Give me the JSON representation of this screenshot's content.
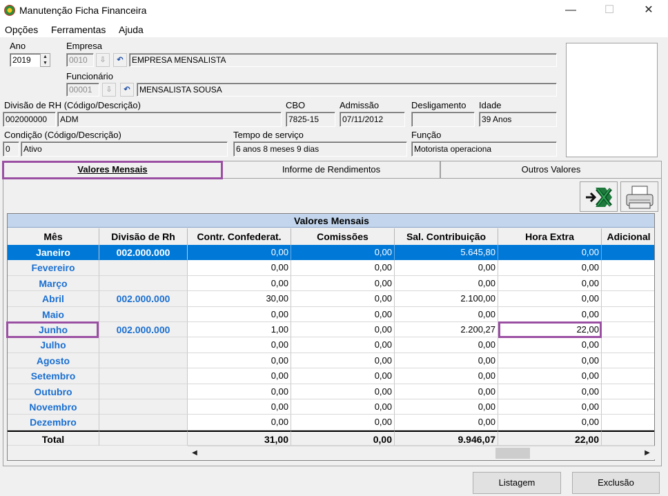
{
  "window": {
    "title": "Manutenção Ficha Financeira",
    "minimize": "—",
    "maximize": "☐",
    "close": "✕"
  },
  "menu": [
    "Opções",
    "Ferramentas",
    "Ajuda"
  ],
  "header": {
    "ano_label": "Ano",
    "ano_value": "2019",
    "empresa_label": "Empresa",
    "empresa_code": "0010",
    "empresa_name": "EMPRESA MENSALISTA",
    "funcionario_label": "Funcionário",
    "funcionario_code": "00001",
    "funcionario_name": "MENSALISTA SOUSA",
    "divisao_label": "Divisão de RH (Código/Descrição)",
    "divisao_code": "002000000",
    "divisao_desc": "ADM",
    "cbo_label": "CBO",
    "cbo_value": "7825-15",
    "admissao_label": "Admissão",
    "admissao_value": "07/11/2012",
    "desligamento_label": "Desligamento",
    "desligamento_value": "",
    "idade_label": "Idade",
    "idade_value": "39 Anos",
    "condicao_label": "Condição (Código/Descrição)",
    "condicao_code": "0",
    "condicao_desc": "Ativo",
    "tempo_label": "Tempo de serviço",
    "tempo_value": "6 anos 8 meses 9 dias",
    "funcao_label": "Função",
    "funcao_value": "Motorista operaciona"
  },
  "tabs": [
    "Valores Mensais",
    "Informe de Rendimentos",
    "Outros Valores"
  ],
  "toolbar": {
    "excel_icon": "excel-export-icon",
    "print_icon": "printer-icon"
  },
  "grid": {
    "caption": "Valores Mensais",
    "columns": [
      "Mês",
      "Divisão de Rh",
      "Contr. Confederat.",
      "Comissões",
      "Sal. Contribuição",
      "Hora Extra",
      "Adicional"
    ],
    "rows": [
      {
        "mes": "Janeiro",
        "divisao": "002.000.000",
        "contr": "0,00",
        "comissoes": "0,00",
        "sal": "5.645,80",
        "hora_extra": "0,00",
        "selected": true
      },
      {
        "mes": "Fevereiro",
        "divisao": "",
        "contr": "0,00",
        "comissoes": "0,00",
        "sal": "0,00",
        "hora_extra": "0,00"
      },
      {
        "mes": "Março",
        "divisao": "",
        "contr": "0,00",
        "comissoes": "0,00",
        "sal": "0,00",
        "hora_extra": "0,00"
      },
      {
        "mes": "Abril",
        "divisao": "002.000.000",
        "contr": "30,00",
        "comissoes": "0,00",
        "sal": "2.100,00",
        "hora_extra": "0,00"
      },
      {
        "mes": "Maio",
        "divisao": "",
        "contr": "0,00",
        "comissoes": "0,00",
        "sal": "0,00",
        "hora_extra": "0,00"
      },
      {
        "mes": "Junho",
        "divisao": "002.000.000",
        "contr": "1,00",
        "comissoes": "0,00",
        "sal": "2.200,27",
        "hora_extra": "22,00"
      },
      {
        "mes": "Julho",
        "divisao": "",
        "contr": "0,00",
        "comissoes": "0,00",
        "sal": "0,00",
        "hora_extra": "0,00"
      },
      {
        "mes": "Agosto",
        "divisao": "",
        "contr": "0,00",
        "comissoes": "0,00",
        "sal": "0,00",
        "hora_extra": "0,00"
      },
      {
        "mes": "Setembro",
        "divisao": "",
        "contr": "0,00",
        "comissoes": "0,00",
        "sal": "0,00",
        "hora_extra": "0,00"
      },
      {
        "mes": "Outubro",
        "divisao": "",
        "contr": "0,00",
        "comissoes": "0,00",
        "sal": "0,00",
        "hora_extra": "0,00"
      },
      {
        "mes": "Novembro",
        "divisao": "",
        "contr": "0,00",
        "comissoes": "0,00",
        "sal": "0,00",
        "hora_extra": "0,00"
      },
      {
        "mes": "Dezembro",
        "divisao": "",
        "contr": "0,00",
        "comissoes": "0,00",
        "sal": "0,00",
        "hora_extra": "0,00"
      }
    ],
    "total": {
      "label": "Total",
      "contr": "31,00",
      "comissoes": "0,00",
      "sal": "9.946,07",
      "hora_extra": "22,00"
    }
  },
  "buttons": {
    "listagem": "Listagem",
    "exclusao": "Exclusão"
  },
  "colors": {
    "selection": "#0078d7",
    "month_text": "#1a6fd1",
    "highlight": "#9b4fa3",
    "caption_bg": "#c2d5ec"
  }
}
